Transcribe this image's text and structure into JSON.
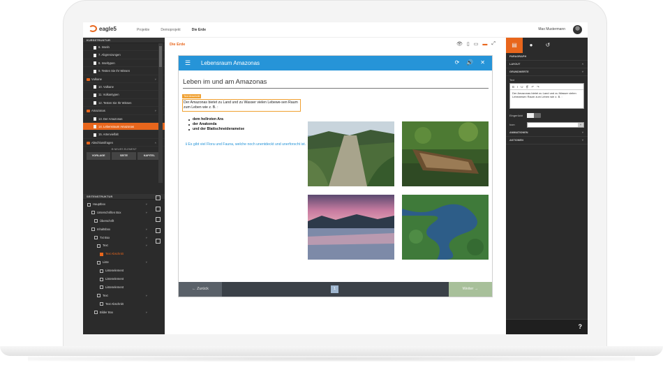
{
  "app": {
    "logo_text": "eagle5",
    "nav": [
      "Projekte",
      "Demoprojekt",
      "Die Erde"
    ],
    "user_name": "Max Mustermann"
  },
  "left_panel": {
    "course_structure_header": "KURSSTRUKTUR",
    "items": [
      {
        "label": "6. Inseln",
        "type": "page"
      },
      {
        "label": "7. Abgrenzungen",
        "type": "page"
      },
      {
        "label": "8. Inseltypen",
        "type": "page"
      },
      {
        "label": "9. Testen Sie Ihr Wissen",
        "type": "page"
      },
      {
        "label": "Vulkane",
        "type": "folder"
      },
      {
        "label": "10. Vulkane",
        "type": "page"
      },
      {
        "label": "11. Vulkantypen",
        "type": "page"
      },
      {
        "label": "12. Testen Sie Ihr Wissen",
        "type": "page"
      },
      {
        "label": "Amazonas",
        "type": "folder"
      },
      {
        "label": "13. Der Amazonas",
        "type": "page"
      },
      {
        "label": "14. Lebensraum Amazonas",
        "type": "page",
        "selected": true
      },
      {
        "label": "15. Artenvielfalt",
        "type": "page"
      },
      {
        "label": "Abschlussfragen",
        "type": "folder"
      }
    ],
    "new_element_label": "NEUES ELEMENT",
    "buttons": [
      "VORLAGE",
      "SEITE",
      "KAPITEL"
    ],
    "page_structure_header": "SEITENSTRUKTUR",
    "page_structure": [
      {
        "label": "Hauptbox",
        "indent": 6
      },
      {
        "label": "Unterschriften Box",
        "indent": 12
      },
      {
        "label": "Überschrift",
        "indent": 16
      },
      {
        "label": "Inhaltsbox",
        "indent": 12
      },
      {
        "label": "Txt Box",
        "indent": 16
      },
      {
        "label": "Text",
        "indent": 20
      },
      {
        "label": "Text Abschnitt",
        "indent": 24,
        "selected": true
      },
      {
        "label": "Liste",
        "indent": 20
      },
      {
        "label": "Listenelement",
        "indent": 24
      },
      {
        "label": "Listenelement",
        "indent": 24
      },
      {
        "label": "Listenelement",
        "indent": 24
      },
      {
        "label": "Text",
        "indent": 20
      },
      {
        "label": "Text Abschnitt",
        "indent": 24
      },
      {
        "label": "Bilder Box",
        "indent": 16
      }
    ]
  },
  "center": {
    "breadcrumb": "Die Erde",
    "viewer_title": "Lebensraum Amazonas",
    "page_heading": "Leben im und am Amazonas",
    "selection_tag": "Text Abschnitt",
    "paragraph": "Der Amazonas bietet zu Land und zu Wasser vielen Lebewe-sen Raum zum Leben wie z. B. :",
    "bullets": [
      "dem hellroten Ara",
      "der Anakonda",
      "und der Blattschneiderameise"
    ],
    "info_text": "Es gibt viel Flora und Fauna, welche noch unentdeckt und unerforscht ist.",
    "back_label": "← Zurück",
    "next_label": "Weiter →",
    "page_number": "1"
  },
  "right_panel": {
    "section_header": "PARAGRAPH",
    "layout": "LAYOUT",
    "grundwerte": "GRUNDWERTE",
    "text_label": "Text",
    "editor_tools": [
      "B",
      "I",
      "U",
      "❡",
      "↶",
      "↷"
    ],
    "editor_text": "Der Amazonas bietet zu Land und zu Wasser vielen Lebewesen Raum zum Leben wie z. B. :",
    "eingeruckt": "Eingerückt",
    "icon_label": "Icon",
    "animationen": "ANIMATIONEN",
    "aktionen": "AKTIONEN"
  },
  "colors": {
    "accent": "#e8661c",
    "header_blue": "#2694d8",
    "panel_dark": "#2b2b2b"
  }
}
